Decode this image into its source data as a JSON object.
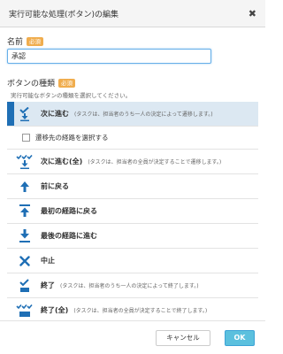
{
  "dialog": {
    "title": "実行可能な処理(ボタン)の編集",
    "close_glyph": "✖"
  },
  "name_field": {
    "label": "名前",
    "required_badge": "必須",
    "value": "承認"
  },
  "button_type": {
    "label": "ボタンの種類",
    "required_badge": "必須",
    "hint": "実行可能なボタンの種類を選択してください。",
    "accent_color": "#1f6fb5",
    "selected_background": "#dce8f2",
    "options": [
      {
        "icon": "check-down-icon",
        "label": "次に進む",
        "description": "(タスクは、担当者のうち一人の決定によって遷移します。)"
      },
      {
        "icon": "checkbox-icon",
        "label": "遷移先の経路を選択する"
      },
      {
        "icon": "multi-check-down-icon",
        "label": "次に進む(全)",
        "description": "(タスクは、担当者の全員が決定することで遷移します。)"
      },
      {
        "icon": "arrow-up-icon",
        "label": "前に戻る"
      },
      {
        "icon": "arrow-to-top-icon",
        "label": "最初の経路に戻る"
      },
      {
        "icon": "arrow-to-bottom-icon",
        "label": "最後の経路に進む"
      },
      {
        "icon": "cross-icon",
        "label": "中止"
      },
      {
        "icon": "check-stop-icon",
        "label": "終了",
        "description": "(タスクは、担当者のうち一人の決定によって終了します。)"
      },
      {
        "icon": "multi-check-stop-icon",
        "label": "終了(全)",
        "description": "(タスクは、担当者の全員が決定することで終了します。)"
      }
    ]
  },
  "footer": {
    "cancel_label": "キャンセル",
    "ok_label": "OK",
    "ok_color": "#5bc0de"
  }
}
